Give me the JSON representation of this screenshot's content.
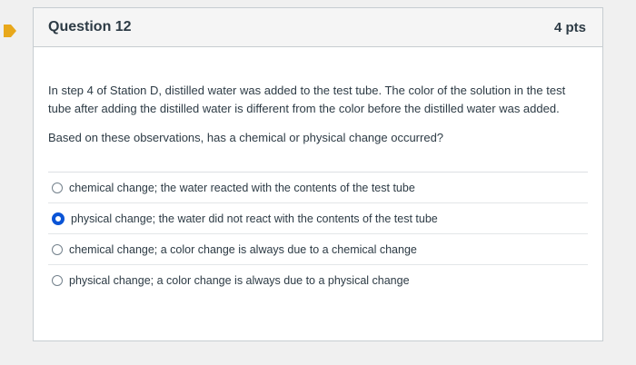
{
  "question": {
    "title": "Question 12",
    "points": "4 pts",
    "text": "In step 4 of Station D, distilled water was added to the test tube. The color of the solution in the test tube after adding the distilled water is different from the color before the distilled water was added.",
    "prompt": "Based on these observations, has a chemical or physical change occurred?",
    "marker_color": "#e8a81b",
    "answers": [
      {
        "label": "chemical change; the water reacted with the contents of the test tube",
        "selected": false
      },
      {
        "label": "physical change; the water did not react with the contents of the test tube",
        "selected": true
      },
      {
        "label": "chemical change; a color change is always due to a chemical change",
        "selected": false
      },
      {
        "label": "physical change; a color change is always due to a physical change",
        "selected": false
      }
    ]
  }
}
